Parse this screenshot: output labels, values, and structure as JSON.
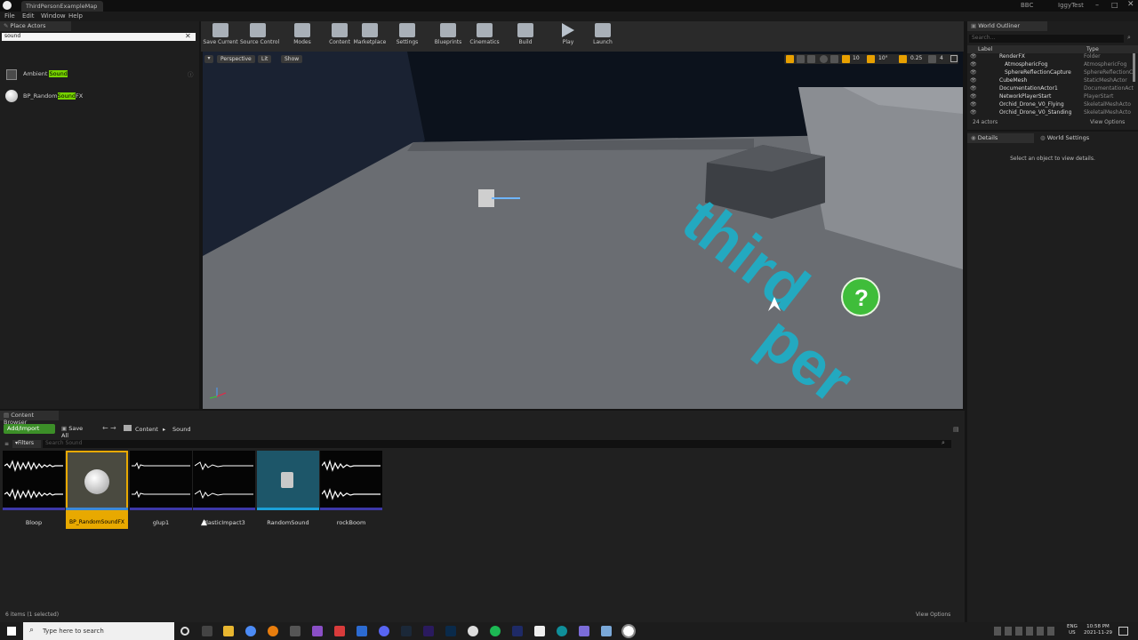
{
  "window": {
    "title": "ThirdPersonExampleMap",
    "project": "IggyTest",
    "source_control": "BBC"
  },
  "menu": [
    "File",
    "Edit",
    "Window",
    "Help"
  ],
  "place_actors": {
    "tab": "Place Actors",
    "search_value": "sound",
    "results": [
      {
        "label": "Ambient Sound",
        "pre": "Ambient ",
        "hl": "Sound",
        "post": ""
      },
      {
        "label": "BP_RandomSoundFX",
        "pre": "BP_Random",
        "hl": "Sound",
        "post": "FX"
      }
    ]
  },
  "toolbar": [
    "Save Current",
    "Source Control",
    "Modes",
    "Content",
    "Marketplace",
    "Settings",
    "Blueprints",
    "Cinematics",
    "Build",
    "Play",
    "Launch"
  ],
  "viewport": {
    "perspective": "Perspective",
    "lit": "Lit",
    "show": "Show",
    "grid_snap": "10",
    "rot_snap": "10°",
    "scale_snap": "0.25",
    "cam_speed": "4",
    "floor_text": "third per"
  },
  "outliner": {
    "tab": "World Outliner",
    "search_placeholder": "Search...",
    "col_label": "Label",
    "col_type": "Type",
    "items": [
      {
        "label": "RenderFX",
        "type": "Folder"
      },
      {
        "label": "AtmosphericFog",
        "type": "AtmosphericFog"
      },
      {
        "label": "SphereReflectionCapture",
        "type": "SphereReflectionC"
      },
      {
        "label": "CubeMesh",
        "type": "StaticMeshActor"
      },
      {
        "label": "DocumentationActor1",
        "type": "DocumentationAct"
      },
      {
        "label": "NetworkPlayerStart",
        "type": "PlayerStart"
      },
      {
        "label": "Orchid_Drone_V0_Flying",
        "type": "SkeletalMeshActo"
      },
      {
        "label": "Orchid_Drone_V0_Standing",
        "type": "SkeletalMeshActo"
      }
    ],
    "count": "24 actors",
    "view_options": "View Options"
  },
  "details": {
    "tab1": "Details",
    "tab2": "World Settings",
    "empty": "Select an object to view details."
  },
  "content_browser": {
    "tab": "Content Browser",
    "add_import": "Add/Import",
    "save_all": "Save All",
    "path": [
      "Content",
      "Sound"
    ],
    "filters": "Filters",
    "search_placeholder": "Search Sound",
    "assets": [
      {
        "name": "Bloop"
      },
      {
        "name": "BP_RandomSoundFX"
      },
      {
        "name": "glup1"
      },
      {
        "name": "PlasticImpact3"
      },
      {
        "name": "RandomSound"
      },
      {
        "name": "rockBoom"
      }
    ],
    "status": "6 items (1 selected)",
    "view_options": "View Options"
  },
  "taskbar": {
    "search_placeholder": "Type here to search",
    "lang": "ENG",
    "region": "US",
    "time": "10:58 PM",
    "date": "2021-11-29"
  },
  "colors": {
    "accent": "#00a7f5",
    "highlight": "#76d300",
    "selected": "#e8a900"
  }
}
